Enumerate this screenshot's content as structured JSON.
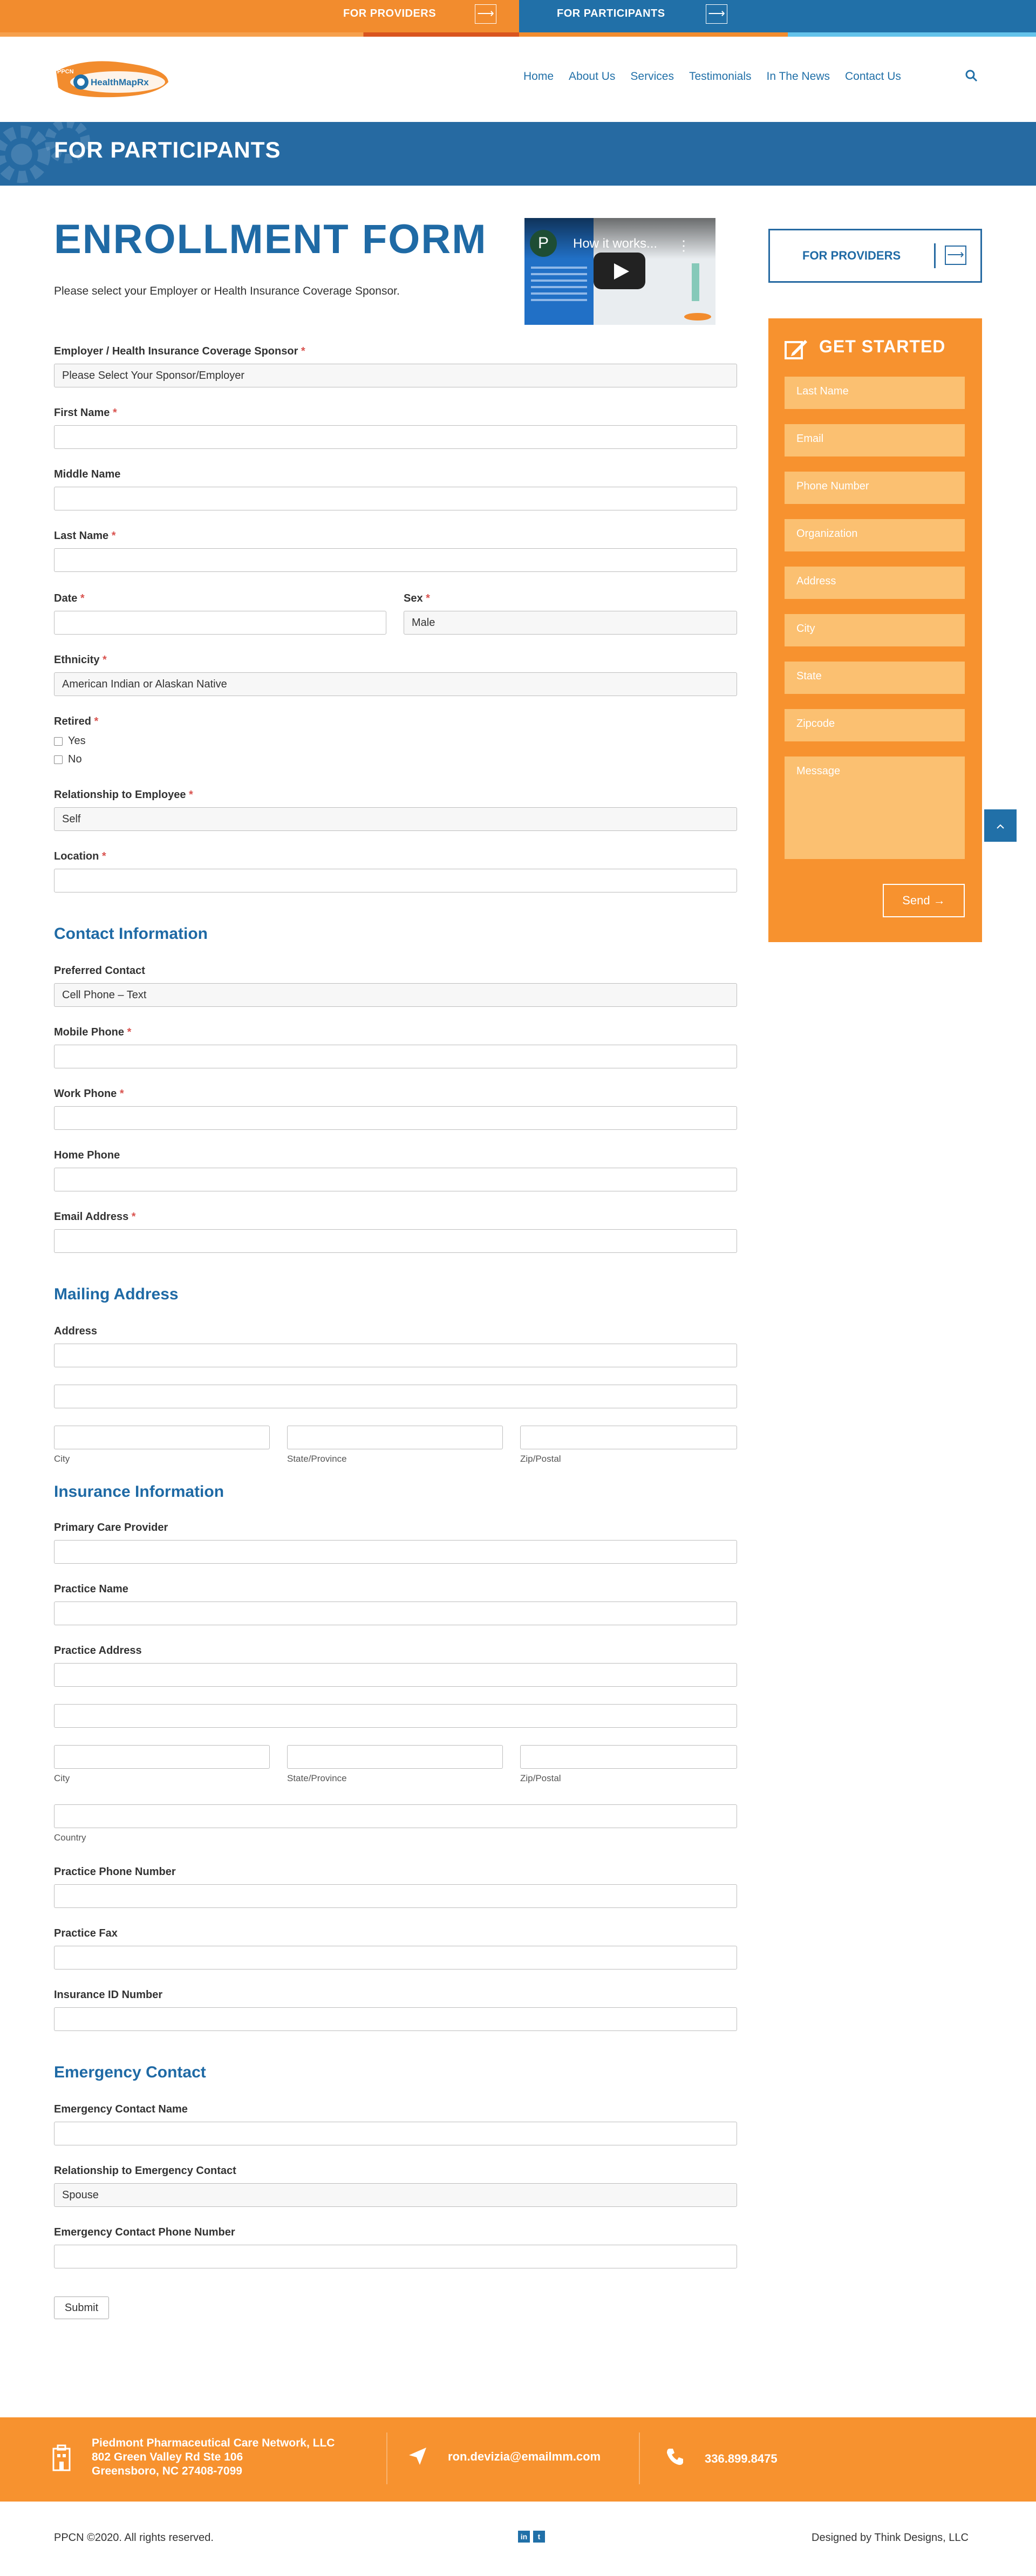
{
  "topbar": {
    "providers_label": "FOR PROVIDERS",
    "participants_label": "FOR PARTICIPANTS",
    "arrow": "⟶"
  },
  "header": {
    "logo_text_small": "PPCN",
    "logo_text": "HealthMapRx",
    "nav": [
      "Home",
      "About Us",
      "Services",
      "Testimonials",
      "In The News",
      "Contact Us"
    ],
    "search_icon": "search-icon"
  },
  "banner": {
    "title": "FOR PARTICIPANTS"
  },
  "main": {
    "title": "ENROLLMENT FORM",
    "subtitle": "Please select your Employer or Health Insurance Coverage Sponsor.",
    "video": {
      "title": "How it works...",
      "channel_initial": "P"
    }
  },
  "form": {
    "sponsor_label": "Employer / Health Insurance Coverage Sponsor",
    "sponsor_value": "Please Select Your Sponsor/Employer",
    "first_name_label": "First Name",
    "middle_name_label": "Middle Name",
    "last_name_label": "Last Name",
    "date_label": "Date",
    "sex_label": "Sex",
    "sex_value": "Male",
    "ethnicity_label": "Ethnicity",
    "ethnicity_value": "American Indian or Alaskan Native",
    "retired_label": "Retired",
    "retired_yes": "Yes",
    "retired_no": "No",
    "relationship_label": "Relationship to Employee",
    "relationship_value": "Self",
    "location_label": "Location",
    "required_mark": "*",
    "contact_section": "Contact Information",
    "preferred_contact_label": "Preferred Contact",
    "preferred_contact_value": "Cell Phone – Text",
    "mobile_label": "Mobile Phone",
    "work_label": "Work Phone",
    "home_label": "Home Phone",
    "email_label": "Email Address",
    "mailing_section": "Mailing Address",
    "address_label": "Address",
    "city": "City",
    "state": "State/Province",
    "zip": "Zip/Postal",
    "insurance_section": "Insurance Information",
    "pcp_label": "Primary Care Provider",
    "practice_name_label": "Practice Name",
    "practice_address_label": "Practice Address",
    "country": "Country",
    "practice_phone_label": "Practice Phone Number",
    "practice_fax_label": "Practice Fax",
    "insurance_id_label": "Insurance ID Number",
    "emergency_section": "Emergency Contact",
    "ec_name_label": "Emergency Contact Name",
    "ec_relationship_label": "Relationship to Emergency Contact",
    "ec_relationship_value": "Spouse",
    "ec_phone_label": "Emergency Contact Phone Number",
    "submit": "Submit"
  },
  "sidebar": {
    "providers_label": "FOR PROVIDERS",
    "get_started": "GET STARTED",
    "fields": [
      "Last Name",
      "Email",
      "Phone Number",
      "Organization",
      "Address",
      "City",
      "State",
      "Zipcode",
      "Message"
    ],
    "send": "Send →"
  },
  "footer": {
    "company": "Piedmont Pharmaceutical Care Network, LLC",
    "street": "802 Green Valley Rd Ste 106",
    "city": "Greensboro, NC 27408-7099",
    "email": "ron.devizia@emailmm.com",
    "phone": "336.899.8475",
    "copyright": "PPCN ©2020. All rights reserved.",
    "credit": "Designed by Think Designs, LLC",
    "linkedin": "in",
    "twitter": "t"
  },
  "colors": {
    "brand_blue": "#2170a8",
    "brand_orange": "#f7922f",
    "field_orange": "#fbc071"
  }
}
